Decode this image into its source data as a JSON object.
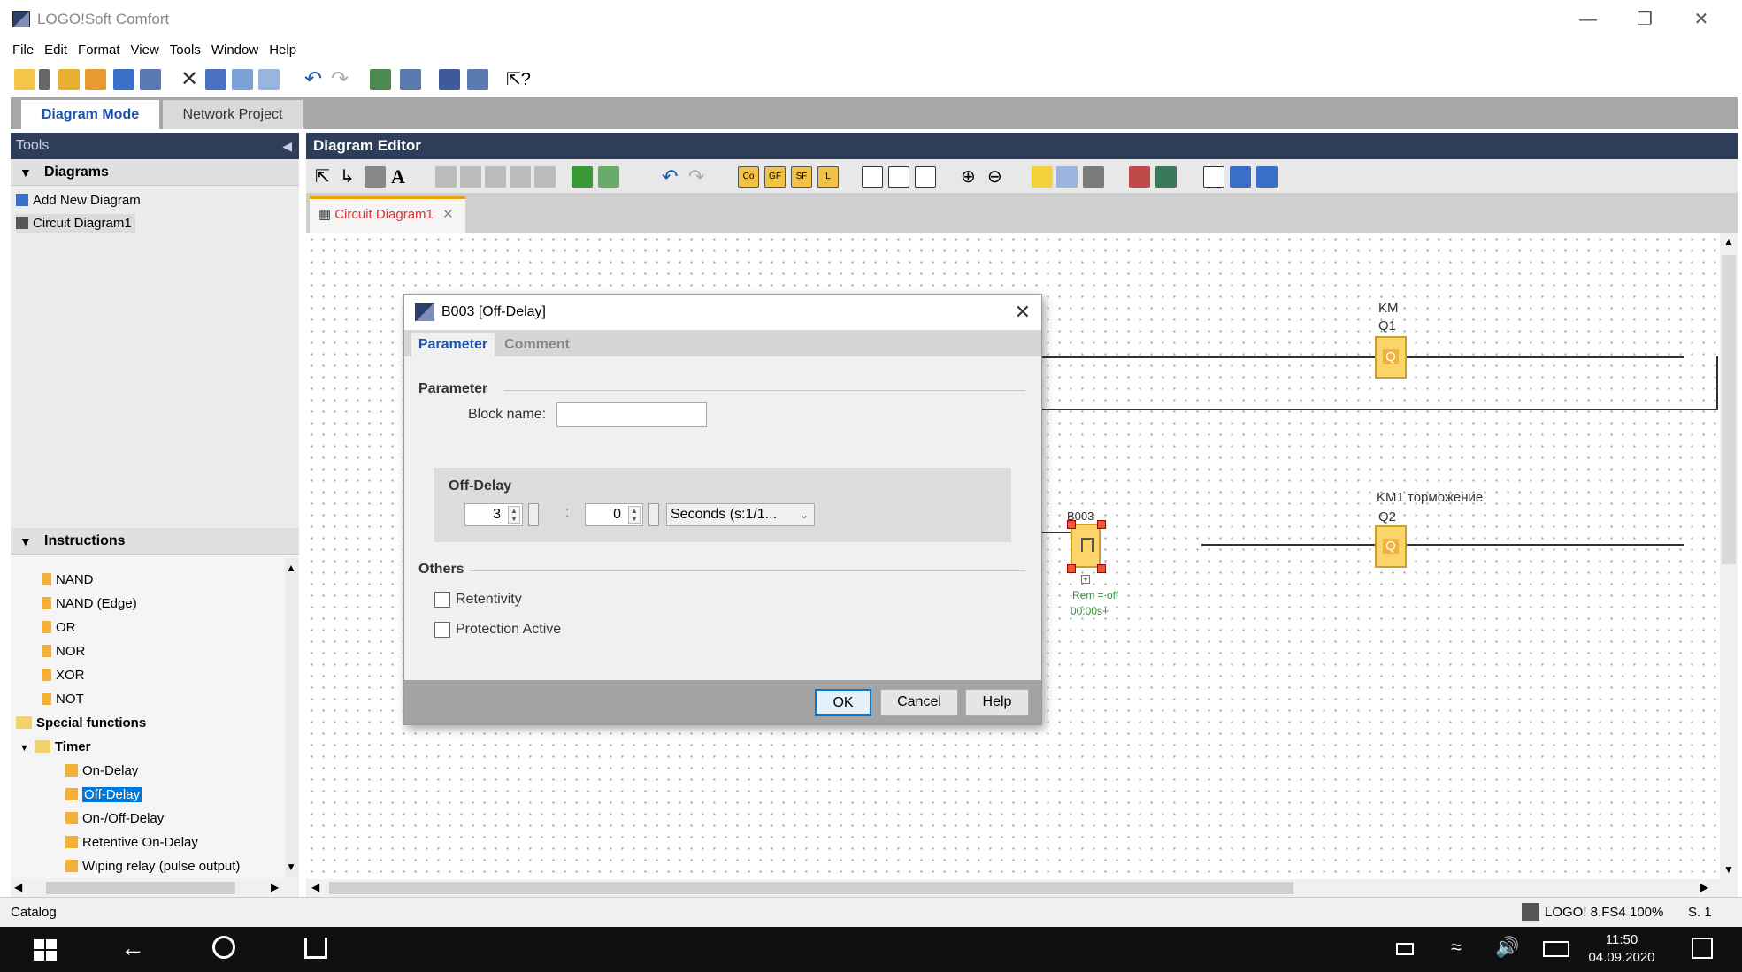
{
  "app": {
    "title": "LOGO!Soft Comfort"
  },
  "menu": [
    "File",
    "Edit",
    "Format",
    "View",
    "Tools",
    "Window",
    "Help"
  ],
  "mode_tabs": [
    "Diagram Mode",
    "Network Project"
  ],
  "tools_panel": {
    "title": "Tools",
    "diagrams_header": "Diagrams",
    "add_new_diagram": "Add New Diagram",
    "diagram_item": "Circuit Diagram1",
    "instructions_header": "Instructions",
    "basic_items": [
      "NAND",
      "NAND (Edge)",
      "OR",
      "NOR",
      "XOR",
      "NOT"
    ],
    "special_functions": "Special functions",
    "timer": "Timer",
    "timer_items": [
      "On-Delay",
      "Off-Delay",
      "On-/Off-Delay",
      "Retentive On-Delay",
      "Wiping relay (pulse output)"
    ],
    "selected_item": "Off-Delay"
  },
  "editor": {
    "title": "Diagram Editor",
    "doc_tab": "Circuit Diagram1",
    "blocks": {
      "q1_name": "KM",
      "q1_id": "Q1",
      "q1_label": "Q",
      "q2_name": "KM1 торможение",
      "q2_id": "Q2",
      "q2_label": "Q",
      "b003_id": "B003",
      "b003_param1": "Rem = off",
      "b003_param2": "00:00s+"
    }
  },
  "dialog": {
    "title": "B003 [Off-Delay]",
    "tabs": [
      "Parameter",
      "Comment"
    ],
    "parameter_group": "Parameter",
    "block_name_label": "Block name:",
    "block_name_value": "",
    "offdelay_group": "Off-Delay",
    "value1": "3",
    "separator": ":",
    "value2": "0",
    "unit": "Seconds (s:1/1...",
    "others_group": "Others",
    "retentivity_label": "Retentivity",
    "retentivity_checked": false,
    "protection_label": "Protection Active",
    "protection_checked": false,
    "ok": "OK",
    "cancel": "Cancel",
    "help": "Help"
  },
  "status": {
    "left": "Catalog",
    "device": "LOGO! 8.FS4",
    "zoom": "100%",
    "page": "S. 1"
  },
  "taskbar": {
    "time": "11:50",
    "date": "04.09.2020"
  },
  "colors": {
    "accent": "#1a56b0",
    "header_bg": "#2d3d5a",
    "block_fill": "#fbd56a",
    "selection": "#0078d7"
  }
}
